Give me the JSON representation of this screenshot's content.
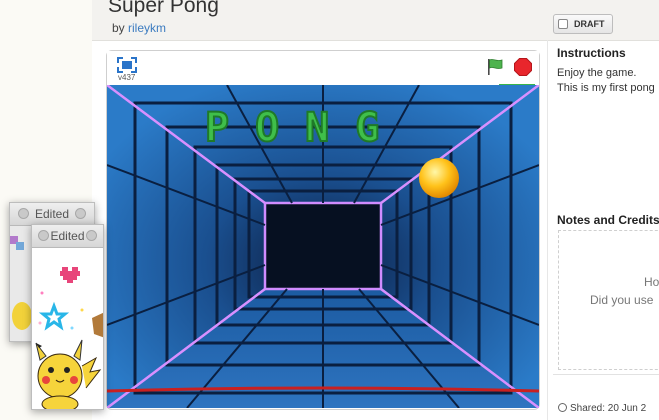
{
  "project": {
    "title": "Super Pong",
    "by_prefix": "by ",
    "author": "rileykm",
    "draft_label": "DRAFT"
  },
  "player": {
    "version": "v437",
    "game_title": "PONG"
  },
  "sidebar": {
    "instructions_title": "Instructions",
    "instructions_lines": [
      "Enjoy the game.",
      "This is my first pong"
    ],
    "notes_title": "Notes and Credits",
    "notes_lines": [
      "Ho",
      "Did you use"
    ],
    "shared": "Shared: 20 Jun 2"
  },
  "windows": {
    "back_title": "Edited",
    "front_title": "Edited"
  },
  "colors": {
    "link": "#3b7bc0",
    "pong_green": "#39b54a",
    "stop_red": "#e8262c",
    "tunnel_blue": "#1d5fa8",
    "ball": "#ffb300"
  }
}
